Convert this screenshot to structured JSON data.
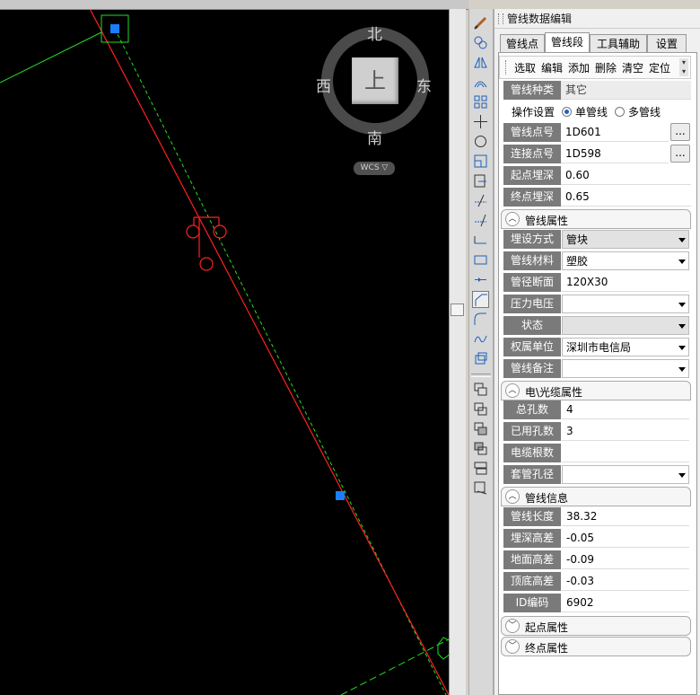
{
  "compass": {
    "north": "北",
    "south": "南",
    "east": "东",
    "west": "西",
    "top": "上",
    "wcs": "WCS ▽"
  },
  "panel": {
    "title": "管线数据编辑",
    "tabs": [
      "管线点",
      "管线段",
      "工具辅助",
      "设置"
    ],
    "actions": [
      "选取",
      "编辑",
      "添加",
      "删除",
      "清空",
      "定位"
    ],
    "line_type": {
      "label": "管线种类",
      "value": "其它"
    },
    "operation": {
      "label": "操作设置",
      "single": "单管线",
      "multi": "多管线"
    },
    "point_no": {
      "label": "管线点号",
      "value": "1D601"
    },
    "conn_no": {
      "label": "连接点号",
      "value": "1D598"
    },
    "start_depth": {
      "label": "起点埋深",
      "value": "0.60"
    },
    "end_depth": {
      "label": "终点埋深",
      "value": "0.65"
    },
    "dots": "..."
  },
  "props": {
    "title": "管线属性",
    "lay_method": {
      "label": "埋设方式",
      "value": "管块"
    },
    "material": {
      "label": "管线材料",
      "value": "塑胶"
    },
    "section": {
      "label": "管径断面",
      "value": "120X30"
    },
    "pressure": {
      "label": "压力电压",
      "value": ""
    },
    "status": {
      "label": "状态",
      "value": ""
    },
    "owner": {
      "label": "权属单位",
      "value": "深圳市电信局"
    },
    "remark": {
      "label": "管线备注",
      "value": ""
    }
  },
  "cable": {
    "title": "电\\光缆属性",
    "total_holes": {
      "label": "总孔数",
      "value": "4"
    },
    "used_holes": {
      "label": "已用孔数",
      "value": "3"
    },
    "cable_count": {
      "label": "电缆根数",
      "value": ""
    },
    "sleeve": {
      "label": "套管孔径",
      "value": ""
    }
  },
  "info": {
    "title": "管线信息",
    "length": {
      "label": "管线长度",
      "value": "38.32"
    },
    "depth_diff": {
      "label": "埋深高差",
      "value": "-0.05"
    },
    "ground_diff": {
      "label": "地面高差",
      "value": "-0.09"
    },
    "top_diff": {
      "label": "顶底高差",
      "value": "-0.03"
    },
    "id_code": {
      "label": "ID编码",
      "value": "6902"
    }
  },
  "start_attr": "起点属性",
  "end_attr": "终点属性",
  "colors": {
    "canvas": "#000000",
    "red_line": "#ff2020",
    "green_line": "#22dd22",
    "grip": "#1a7fff",
    "label_bg": "#7a7a7a"
  }
}
